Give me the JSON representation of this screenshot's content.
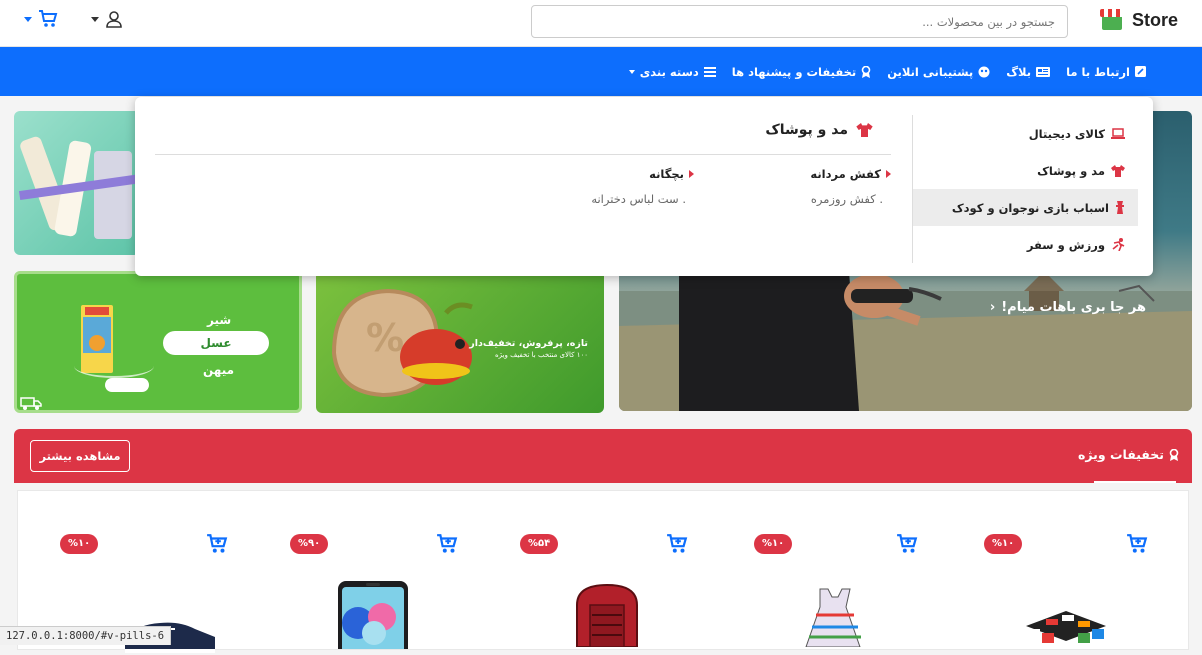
{
  "header": {
    "brand": "Store",
    "search_placeholder": "جستجو در بین محصولات ..."
  },
  "nav": {
    "items": [
      {
        "label": "دسته بندی",
        "icon": "bars-icon"
      },
      {
        "label": "تخفیفات و پیشنهاد ها",
        "icon": "award-icon"
      },
      {
        "label": "پشتیبانی انلاین",
        "icon": "headset-icon"
      },
      {
        "label": "بلاگ",
        "icon": "newspaper-icon"
      },
      {
        "label": "ارتباط با ما",
        "icon": "contact-icon"
      }
    ]
  },
  "dropdown": {
    "menu": [
      {
        "label": "کالای دیجیتال",
        "icon": "laptop-icon"
      },
      {
        "label": "مد و پوشاک",
        "icon": "shirt-icon"
      },
      {
        "label": "اسباب بازی نوجوان و کودک",
        "icon": "toy-icon"
      },
      {
        "label": "ورزش و سفر",
        "icon": "running-icon"
      }
    ],
    "title": "مد و پوشاک",
    "columns": [
      {
        "heading": "کفش مردانه",
        "sub": ". کفش روزمره"
      },
      {
        "heading": "بچگانه",
        "sub": ". ست لباس دخترانه"
      }
    ]
  },
  "banners": {
    "b2_text": "هر جا بری باهات میام!",
    "b3_title": "تازه، پرفروش، تخفیف‌دار",
    "b3_sub": "۱۰۰ کالای منتخب با تخفیف ویژه",
    "b4_words": [
      "شیر",
      "عسل",
      "میهن"
    ]
  },
  "special": {
    "title": "تخفیفات ویژه",
    "more": "مشاهده بیشتر"
  },
  "products": [
    {
      "badge": "%۱۰"
    },
    {
      "badge": "%۱۰"
    },
    {
      "badge": "%۵۴"
    },
    {
      "badge": "%۹۰"
    },
    {
      "badge": "%۱۰"
    }
  ],
  "status_url": "127.0.0.1:8000/#v-pills-6",
  "colors": {
    "primary": "#0d6efd",
    "danger": "#dc3545"
  }
}
